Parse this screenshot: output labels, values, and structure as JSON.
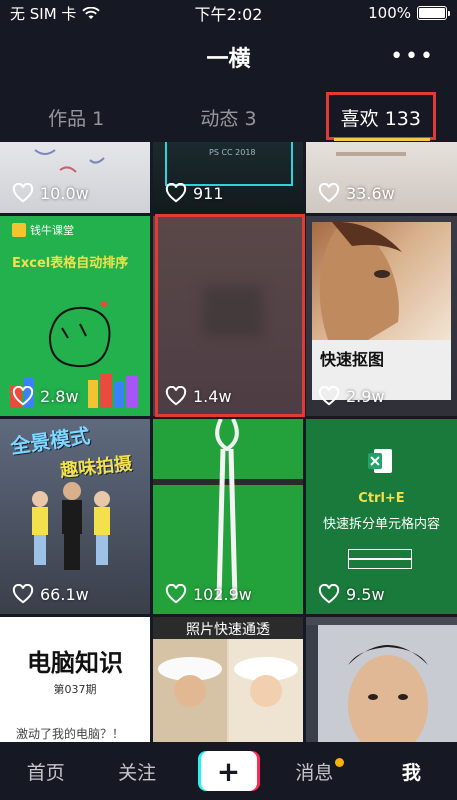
{
  "status_bar": {
    "carrier": "无 SIM 卡",
    "time": "下午2:02",
    "battery": "100%"
  },
  "header": {
    "title": "一横",
    "more": "•••"
  },
  "tabs": [
    {
      "label": "作品 1"
    },
    {
      "label": "动态 3"
    },
    {
      "label": "喜欢 133"
    }
  ],
  "grid": {
    "likes": [
      "10.0w",
      "911",
      "33.6w",
      "2.8w",
      "1.4w",
      "2.9w",
      "66.1w",
      "102.9w",
      "9.5w"
    ],
    "thumb_texts": {
      "t_r1a_brand": "钱牛课堂",
      "t_r1a_title": "Excel表格自动排序",
      "t_r1c_title": "快速抠图",
      "t_r2a_title1": "全景模式",
      "t_r2a_title2": "趣味拍摄",
      "t_r2c_line1": "Ctrl+E",
      "t_r2c_line2": "快速拆分单元格内容",
      "t_r3a_title": "电脑知识",
      "t_r3a_issue": "第037期",
      "t_r3a_sub": "激动了我的电脑？！",
      "t_r3b_title": "照片快速通透",
      "t_r0b_code": "PS CC 2018"
    }
  },
  "bottom_nav": {
    "home": "首页",
    "follow": "关注",
    "plus": "+",
    "messages": "消息",
    "me": "我"
  },
  "colors": {
    "tab_highlight": "#e53935",
    "tab_underline": "#f2c94c",
    "notification_dot": "#f7b500",
    "plus_left": "#25f4ee",
    "plus_right": "#fe2c55"
  }
}
